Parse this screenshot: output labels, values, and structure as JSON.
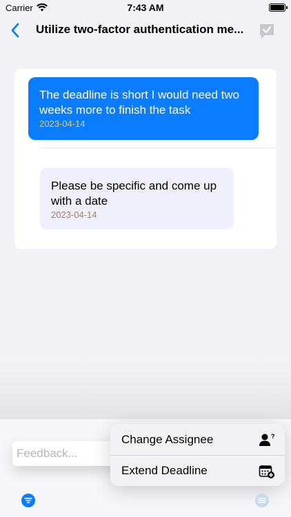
{
  "status_bar": {
    "carrier": "Carrier",
    "time": "7:43 AM"
  },
  "nav": {
    "title": "Utilize two-factor authentication me...",
    "back_icon": "chevron-left-icon",
    "approve_icon": "checkmark-bubble-icon"
  },
  "messages": [
    {
      "direction": "outgoing",
      "text": "The deadline is short I would need two weeks more to finish the task",
      "date": "2023-04-14"
    },
    {
      "direction": "incoming",
      "text": "Please be specific and come up with a date",
      "date": "2023-04-14"
    }
  ],
  "composer": {
    "placeholder": "Feedback...",
    "value": ""
  },
  "menu": {
    "items": [
      {
        "label": "Change Assignee",
        "icon": "person-question-icon"
      },
      {
        "label": "Extend Deadline",
        "icon": "calendar-plus-icon"
      }
    ]
  },
  "colors": {
    "accent": "#0a7cff",
    "outgoing_date": "#e8cf5a",
    "incoming_date": "#a77f5e",
    "incoming_bubble": "#f0effc"
  }
}
